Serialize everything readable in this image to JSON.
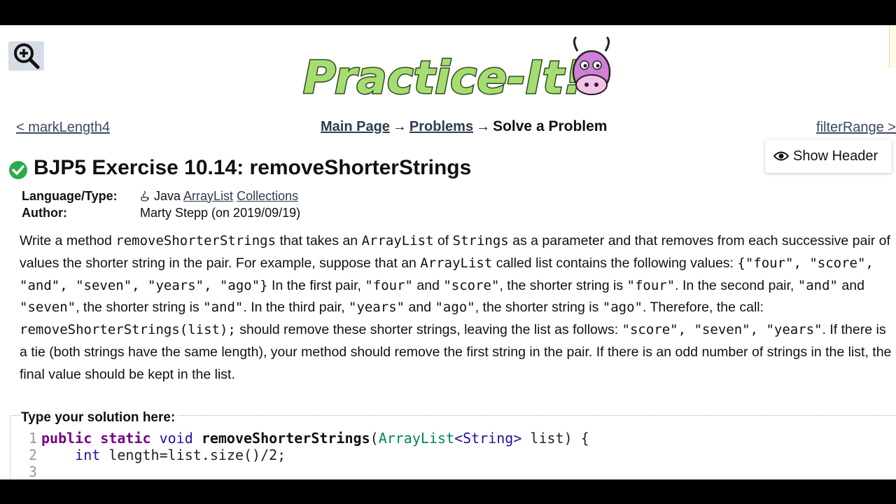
{
  "logo": {
    "text": "Practice-It!"
  },
  "nav": {
    "prev": "< markLength4",
    "next": "filterRange >",
    "breadcrumb": {
      "main": "Main Page",
      "arrow": "→",
      "problems": "Problems",
      "current": "Solve a Problem"
    }
  },
  "show_header": {
    "label": "Show Header"
  },
  "problem": {
    "title": "BJP5 Exercise 10.14: removeShorterStrings",
    "language_label": "Language/Type:",
    "language": "Java",
    "tags": [
      "ArrayList",
      "Collections"
    ],
    "author_label": "Author:",
    "author": "Marty Stepp (on 2019/09/19)"
  },
  "description": {
    "t1": "Write a method ",
    "c1": "removeShorterStrings",
    "t2": " that takes an ",
    "c2": "ArrayList",
    "t3": " of ",
    "c3": "Strings",
    "t4": " as a parameter and that removes from each successive pair of values the shorter string in the pair. For example, suppose that an ",
    "c4": "ArrayList",
    "t5": " called list contains the following values: ",
    "c5": "{\"four\", \"score\", \"and\", \"seven\", \"years\", \"ago\"}",
    "t6": " In the first pair, ",
    "c6": "\"four\"",
    "t7": " and ",
    "c7": "\"score\"",
    "t8": ", the shorter string is ",
    "c8": "\"four\"",
    "t9": ". In the second pair, ",
    "c9": "\"and\"",
    "t10": " and ",
    "c10": "\"seven\"",
    "t11": ", the shorter string is ",
    "c11": "\"and\"",
    "t12": ". In the third pair, ",
    "c12": "\"years\"",
    "t13": " and ",
    "c13": "\"ago\"",
    "t14": ", the shorter string is ",
    "c14": "\"ago\"",
    "t15": ". Therefore, the call: ",
    "c15": "removeShorterStrings(list);",
    "t16": " should remove these shorter strings, leaving the list as follows: ",
    "c16": "\"score\", \"seven\", \"years\"",
    "t17": ". If there is a tie (both strings have the same length), your method should remove the first string in the pair. If there is an odd number of strings in the list, the final value should be kept in the list."
  },
  "solution": {
    "label": "Type your solution here:",
    "line_numbers": [
      "1",
      "2",
      "3"
    ],
    "line1": {
      "kw1": "public",
      "kw2": "static",
      "kw3": "void",
      "name": "removeShorterStrings",
      "p1": "(",
      "type": "ArrayList",
      "gen": "<String>",
      "p2": " list) {"
    },
    "line2": {
      "indent": "    ",
      "kw": "int",
      "rest": " length=list.size()/2;"
    }
  },
  "colors": {
    "link": "#2c3d52",
    "check": "#2eaa4a",
    "keyword": "#770088",
    "type": "#008855"
  }
}
